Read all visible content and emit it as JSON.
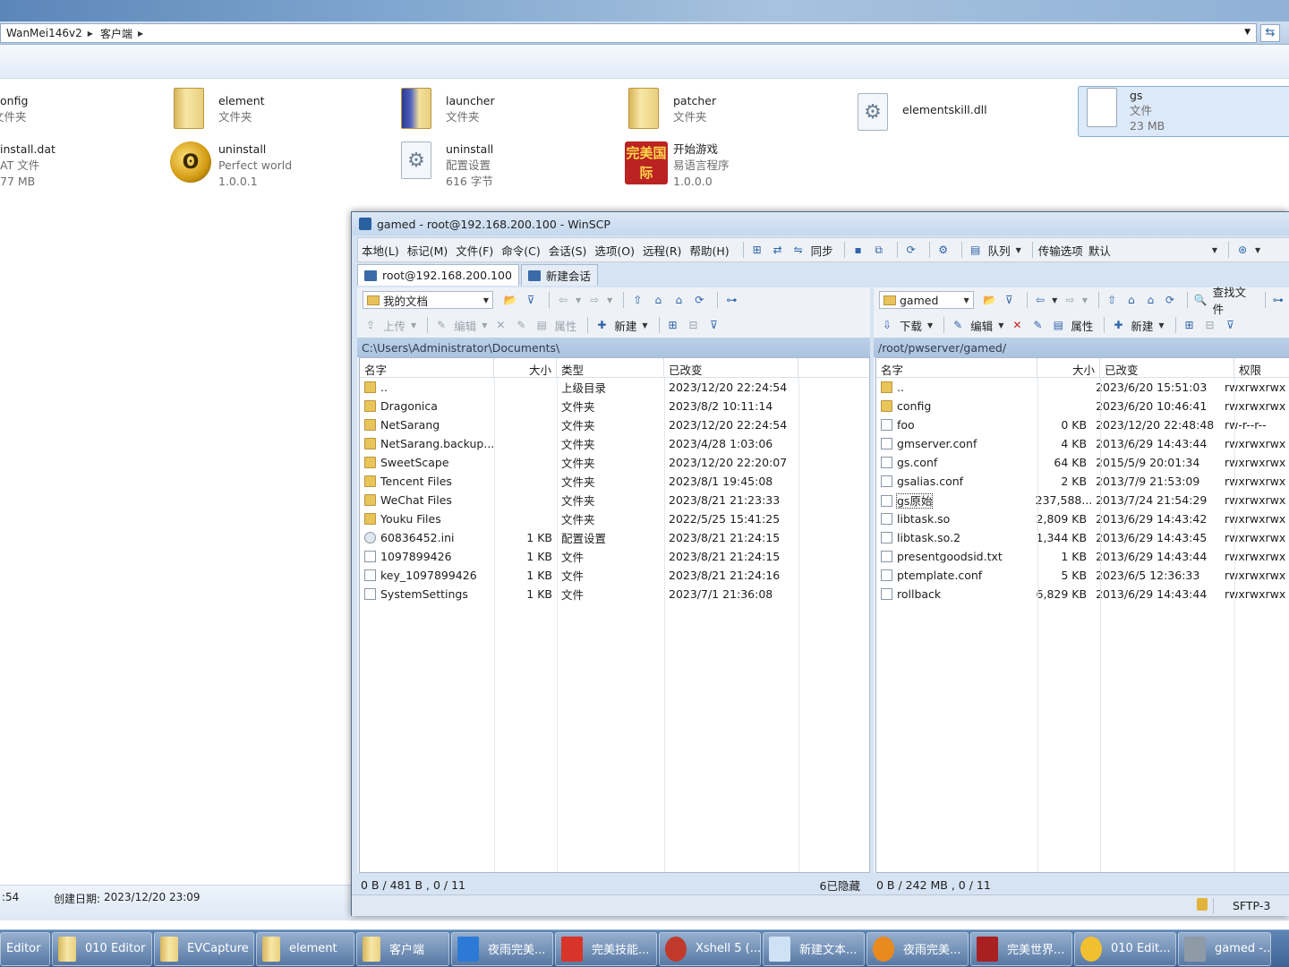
{
  "explorer": {
    "breadcrumb": [
      "WanMei146v2",
      "客户端"
    ],
    "items_row1": [
      {
        "name": "onfig",
        "sub1": "文件夹",
        "sub2": ""
      },
      {
        "name": "element",
        "sub1": "文件夹",
        "sub2": ""
      },
      {
        "name": "launcher",
        "sub1": "文件夹",
        "sub2": ""
      },
      {
        "name": "patcher",
        "sub1": "文件夹",
        "sub2": ""
      },
      {
        "name": "elementskill.dll",
        "sub1": "",
        "sub2": ""
      },
      {
        "name": "gs",
        "sub1": "文件",
        "sub2": "23 MB"
      }
    ],
    "items_row2": [
      {
        "name": "install.dat",
        "sub1": "AT 文件",
        "sub2": "77 MB"
      },
      {
        "name": "uninstall",
        "sub1": "Perfect world",
        "sub2": "1.0.0.1"
      },
      {
        "name": "uninstall",
        "sub1": "配置设置",
        "sub2": "616 字节"
      },
      {
        "name": "开始游戏",
        "sub1": "易语言程序",
        "sub2": "1.0.0.0"
      }
    ],
    "game_icon_text": "完美国际",
    "status_time": ":54",
    "status_created_label": "创建日期:",
    "status_created_value": "2023/12/20 23:09"
  },
  "winscp": {
    "title": "gamed - root@192.168.200.100 - WinSCP",
    "menu": [
      "本地(L)",
      "标记(M)",
      "文件(F)",
      "命令(C)",
      "会话(S)",
      "选项(O)",
      "远程(R)",
      "帮助(H)"
    ],
    "toolbar": {
      "sync_label": "同步",
      "queue_label": "队列",
      "transfer_label": "传输选项",
      "transfer_value": "默认"
    },
    "tabs": {
      "session": "root@192.168.200.100",
      "new_session": "新建会话"
    },
    "left": {
      "location": "我的文档",
      "upload_label": "上传",
      "edit_label": "编辑",
      "properties_label": "属性",
      "new_label": "新建",
      "path": "C:\\Users\\Administrator\\Documents\\",
      "columns": [
        "名字",
        "大小",
        "类型",
        "已改变"
      ],
      "rows": [
        {
          "name": "..",
          "size": "",
          "type": "上级目录",
          "changed": "2023/12/20  22:24:54",
          "icon": "up"
        },
        {
          "name": "Dragonica",
          "size": "",
          "type": "文件夹",
          "changed": "2023/8/2  10:11:14",
          "icon": "folder"
        },
        {
          "name": "NetSarang",
          "size": "",
          "type": "文件夹",
          "changed": "2023/12/20  22:24:54",
          "icon": "folder"
        },
        {
          "name": "NetSarang.backup...",
          "size": "",
          "type": "文件夹",
          "changed": "2023/4/28  1:03:06",
          "icon": "folder"
        },
        {
          "name": "SweetScape",
          "size": "",
          "type": "文件夹",
          "changed": "2023/12/20  22:20:07",
          "icon": "folder"
        },
        {
          "name": "Tencent Files",
          "size": "",
          "type": "文件夹",
          "changed": "2023/8/1  19:45:08",
          "icon": "folder"
        },
        {
          "name": "WeChat Files",
          "size": "",
          "type": "文件夹",
          "changed": "2023/8/21  21:23:33",
          "icon": "folder"
        },
        {
          "name": "Youku Files",
          "size": "",
          "type": "文件夹",
          "changed": "2022/5/25  15:41:25",
          "icon": "folder"
        },
        {
          "name": "60836452.ini",
          "size": "1 KB",
          "type": "配置设置",
          "changed": "2023/8/21  21:24:15",
          "icon": "cfg"
        },
        {
          "name": "1097899426",
          "size": "1 KB",
          "type": "文件",
          "changed": "2023/8/21  21:24:15",
          "icon": "file"
        },
        {
          "name": "key_1097899426",
          "size": "1 KB",
          "type": "文件",
          "changed": "2023/8/21  21:24:16",
          "icon": "file"
        },
        {
          "name": "SystemSettings",
          "size": "1 KB",
          "type": "文件",
          "changed": "2023/7/1  21:36:08",
          "icon": "file"
        }
      ],
      "status": "0 B / 481 B ,  0 / 11",
      "hidden": "6已隐藏"
    },
    "right": {
      "location": "gamed",
      "find_label": "查找文件",
      "download_label": "下载",
      "edit_label": "编辑",
      "properties_label": "属性",
      "new_label": "新建",
      "path": "/root/pwserver/gamed/",
      "columns": [
        "名字",
        "大小",
        "已改变",
        "权限"
      ],
      "rows": [
        {
          "name": "..",
          "size": "",
          "changed": "2023/6/20 15:51:03",
          "perm": "rwxrwxrwx",
          "icon": "up"
        },
        {
          "name": "config",
          "size": "",
          "changed": "2023/6/20 10:46:41",
          "perm": "rwxrwxrwx",
          "icon": "folder"
        },
        {
          "name": "foo",
          "size": "0 KB",
          "changed": "2023/12/20 22:48:48",
          "perm": "rw-r--r--",
          "icon": "file"
        },
        {
          "name": "gmserver.conf",
          "size": "4 KB",
          "changed": "2013/6/29 14:43:44",
          "perm": "rwxrwxrwx",
          "icon": "file"
        },
        {
          "name": "gs.conf",
          "size": "64 KB",
          "changed": "2015/5/9 20:01:34",
          "perm": "rwxrwxrwx",
          "icon": "file"
        },
        {
          "name": "gsalias.conf",
          "size": "2 KB",
          "changed": "2013/7/9 21:53:09",
          "perm": "rwxrwxrwx",
          "icon": "file"
        },
        {
          "name": "gs原始",
          "size": "237,588...",
          "changed": "2013/7/24 21:54:29",
          "perm": "rwxrwxrwx",
          "icon": "file"
        },
        {
          "name": "libtask.so",
          "size": "2,809 KB",
          "changed": "2013/6/29 14:43:42",
          "perm": "rwxrwxrwx",
          "icon": "file"
        },
        {
          "name": "libtask.so.2",
          "size": "1,344 KB",
          "changed": "2013/6/29 14:43:45",
          "perm": "rwxrwxrwx",
          "icon": "file"
        },
        {
          "name": "presentgoodsid.txt",
          "size": "1 KB",
          "changed": "2013/6/29 14:43:44",
          "perm": "rwxrwxrwx",
          "icon": "file"
        },
        {
          "name": "ptemplate.conf",
          "size": "5 KB",
          "changed": "2023/6/5 12:36:33",
          "perm": "rwxrwxrwx",
          "icon": "file"
        },
        {
          "name": "rollback",
          "size": "6,829 KB",
          "changed": "2013/6/29 14:43:44",
          "perm": "rwxrwxrwx",
          "icon": "file"
        }
      ],
      "status": "0 B / 242 MB ,  0 / 11"
    },
    "protocol": "SFTP-3"
  },
  "taskbar": [
    {
      "label": "Editor",
      "icon": "none"
    },
    {
      "label": "010 Editor",
      "icon": "folder"
    },
    {
      "label": "EVCapture",
      "icon": "folder"
    },
    {
      "label": "element",
      "icon": "folder"
    },
    {
      "label": "客户端",
      "icon": "folder"
    },
    {
      "label": "夜雨完美...",
      "icon": "blue"
    },
    {
      "label": "完美技能...",
      "icon": "red"
    },
    {
      "label": "Xshell 5 (...",
      "icon": "shell"
    },
    {
      "label": "新建文本...",
      "icon": "doc"
    },
    {
      "label": "夜雨完美...",
      "icon": "orange"
    },
    {
      "label": "完美世界...",
      "icon": "game"
    },
    {
      "label": "010 Edit...",
      "icon": "yellow"
    },
    {
      "label": "gamed -...",
      "icon": "lock"
    }
  ]
}
